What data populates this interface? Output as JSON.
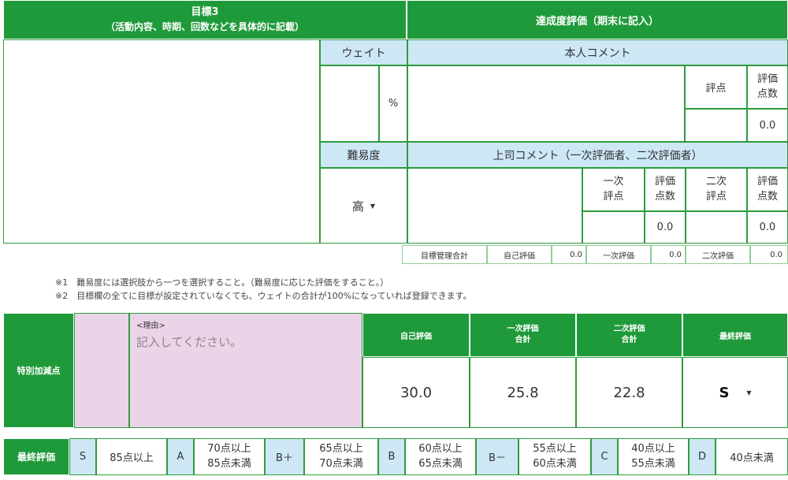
{
  "goal_header": {
    "title": "目標3",
    "subtitle": "（活動内容、時期、回数などを具体的に記載）"
  },
  "achievement_header": "達成度評価（期末に記入）",
  "weight": {
    "label": "ウェイト",
    "unit": "%"
  },
  "self_comment_label": "本人コメント",
  "score_label": "評点",
  "score_points_label_1": "評価",
  "score_points_label_2": "点数",
  "self_points": "0.0",
  "difficulty": {
    "label": "難易度",
    "value": "高",
    "arrow": "▼"
  },
  "boss_comment_label": "上司コメント（一次評価者、二次評価者）",
  "first_score_1": "一次",
  "first_score_2": "評点",
  "second_score_1": "二次",
  "second_score_2": "評点",
  "first_points": "0.0",
  "second_points": "0.0",
  "summary": {
    "total_label": "目標管理合計",
    "self_label": "自己評価",
    "self_value": "0.0",
    "first_label": "一次評価",
    "first_value": "0.0",
    "second_label": "二次評価",
    "second_value": "0.0"
  },
  "notes": {
    "n1": "※1　難易度には選択肢から一つを選択すること。（難易度に応じた評価をすること。）",
    "n2": "※2　目標欄の全てに目標が設定されていなくても、ウェイトの合計が100%になっていれば登録できます。"
  },
  "special": {
    "label": "特別加減点",
    "reason_label": "<理由>",
    "reason_placeholder": "記入してください。",
    "self_eval_label": "自己評価",
    "first_total_1": "一次評価",
    "first_total_2": "合計",
    "second_total_1": "二次評価",
    "second_total_2": "合計",
    "final_label": "最終評価",
    "self_value": "30.0",
    "first_value": "25.8",
    "second_value": "22.8",
    "final_value": "S",
    "final_arrow": "▼"
  },
  "grades": {
    "label": "最終評価",
    "items": [
      {
        "grade": "S",
        "range1": "85点以上",
        "range2": ""
      },
      {
        "grade": "A",
        "range1": "70点以上",
        "range2": "85点未満"
      },
      {
        "grade": "B＋",
        "range1": "65点以上",
        "range2": "70点未満"
      },
      {
        "grade": "B",
        "range1": "60点以上",
        "range2": "65点未満"
      },
      {
        "grade": "B－",
        "range1": "55点以上",
        "range2": "60点未満"
      },
      {
        "grade": "C",
        "range1": "40点以上",
        "range2": "55点未満"
      },
      {
        "grade": "D",
        "range1": "40点未満",
        "range2": ""
      }
    ]
  }
}
